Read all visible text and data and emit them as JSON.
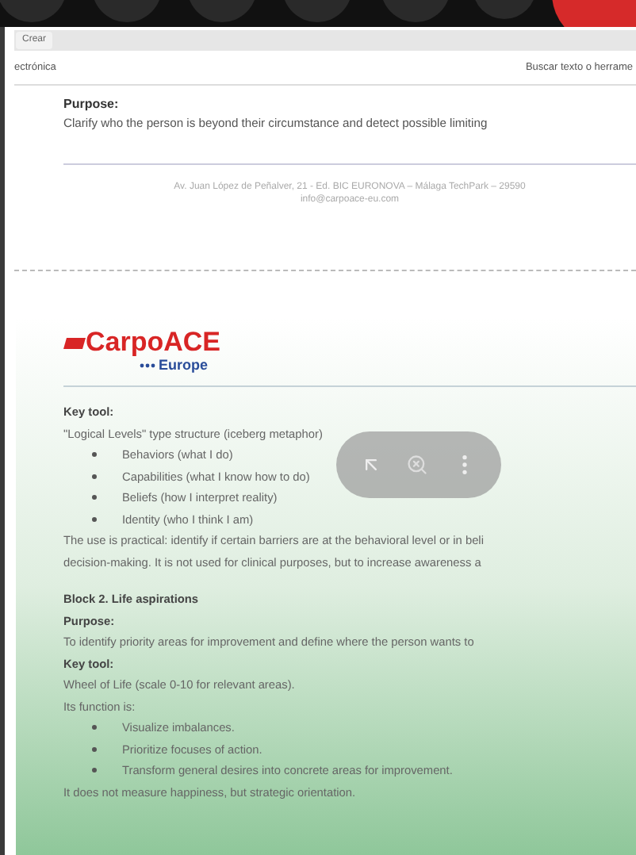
{
  "toolbar": {
    "create_button": "Crear",
    "left_label": "ectrónica",
    "search_placeholder": "Buscar texto o herrame"
  },
  "page_1": {
    "purpose_label": "Purpose:",
    "purpose_text": "Clarify who the person is beyond their circumstance and detect possible limiting",
    "footer_address": "Av. Juan López de Peñalver, 21 - Ed. BIC EURONOVA – Málaga TechPark – 29590",
    "footer_email": "info@carpoace-eu.com"
  },
  "page_2": {
    "logo": {
      "name": "CarpoACE",
      "subtitle": "Europe"
    },
    "lines": [
      {
        "kind": "label",
        "text": "Key tool:"
      },
      {
        "kind": "text",
        "text": "\"Logical Levels\" type structure (iceberg metaphor)"
      },
      {
        "kind": "bullet",
        "text": "Behaviors (what I do)"
      },
      {
        "kind": "bullet",
        "text": "Capabilities (what I know how to do)"
      },
      {
        "kind": "bullet",
        "text": "Beliefs (how I interpret reality)"
      },
      {
        "kind": "bullet",
        "text": "Identity (who I think I am)"
      },
      {
        "kind": "text",
        "text": "The use is practical: identify if certain barriers are at the behavioral level or in beli"
      },
      {
        "kind": "text",
        "text": "decision-making. It is not used for clinical purposes, but to increase awareness a"
      },
      {
        "kind": "heading",
        "text": "Block 2. Life aspirations"
      },
      {
        "kind": "label",
        "text": "Purpose:"
      },
      {
        "kind": "text",
        "text": "To identify priority areas for improvement and define where the person wants to"
      },
      {
        "kind": "label",
        "text": "Key tool:"
      },
      {
        "kind": "text",
        "text": "Wheel of Life (scale 0-10 for relevant areas)."
      },
      {
        "kind": "text",
        "text": "Its function is:"
      },
      {
        "kind": "bullet",
        "text": "Visualize imbalances."
      },
      {
        "kind": "bullet",
        "text": "Prioritize focuses of action."
      },
      {
        "kind": "bullet",
        "text": "Transform general desires into concrete areas for improvement."
      },
      {
        "kind": "text",
        "text": "It does not measure happiness, but strategic orientation."
      }
    ]
  }
}
